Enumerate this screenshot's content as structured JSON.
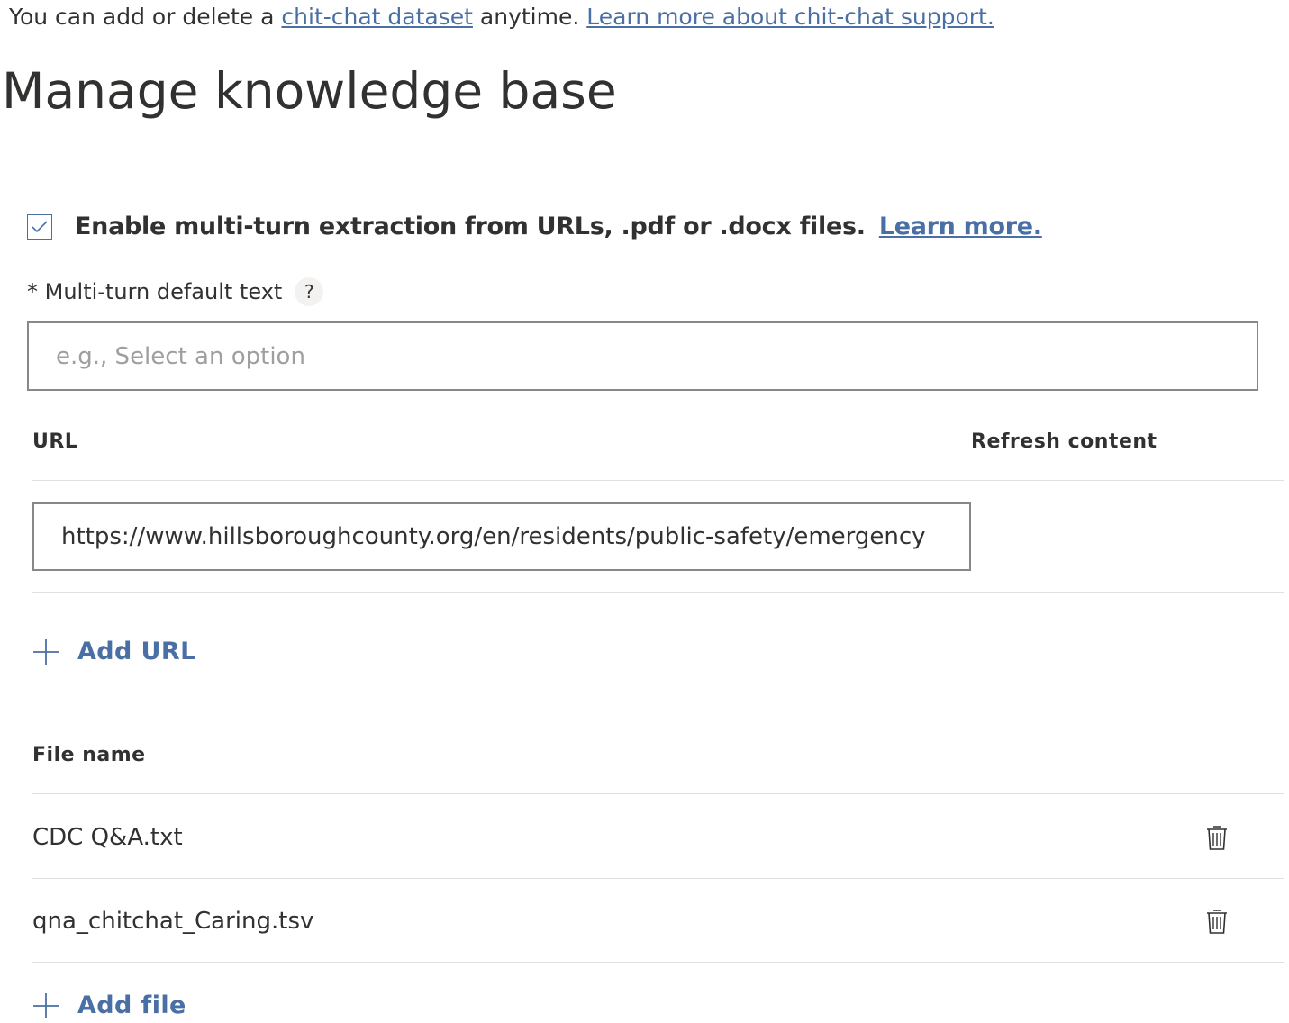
{
  "intro": {
    "prefix": "You can add or delete a ",
    "chitchat_link": "chit-chat dataset",
    "middle": " anytime. ",
    "learn_more_link": "Learn more about chit-chat support."
  },
  "page_title": "Manage knowledge base",
  "multi_turn": {
    "checked": true,
    "label": "Enable multi-turn extraction from URLs, .pdf or .docx files.",
    "learn_more": "Learn more.",
    "default_text_label": "* Multi-turn default text",
    "help_glyph": "?",
    "default_text_value": "",
    "default_text_placeholder": "e.g., Select an option"
  },
  "urls": {
    "col_url": "URL",
    "col_refresh": "Refresh content",
    "items": [
      {
        "value": "https://www.hillsboroughcounty.org/en/residents/public-safety/emergency"
      }
    ],
    "add_label": "Add URL"
  },
  "files": {
    "col_name": "File name",
    "items": [
      {
        "name": "CDC Q&A.txt"
      },
      {
        "name": "qna_chitchat_Caring.tsv"
      }
    ],
    "add_label": "Add file"
  },
  "icons": {
    "checkbox": "check-icon",
    "help": "help-icon",
    "add": "plus-icon",
    "delete": "trash-icon"
  },
  "colors": {
    "link": "#4a6fa5",
    "text": "#323130",
    "border": "#8a8886",
    "divider": "#e1dfdd"
  }
}
